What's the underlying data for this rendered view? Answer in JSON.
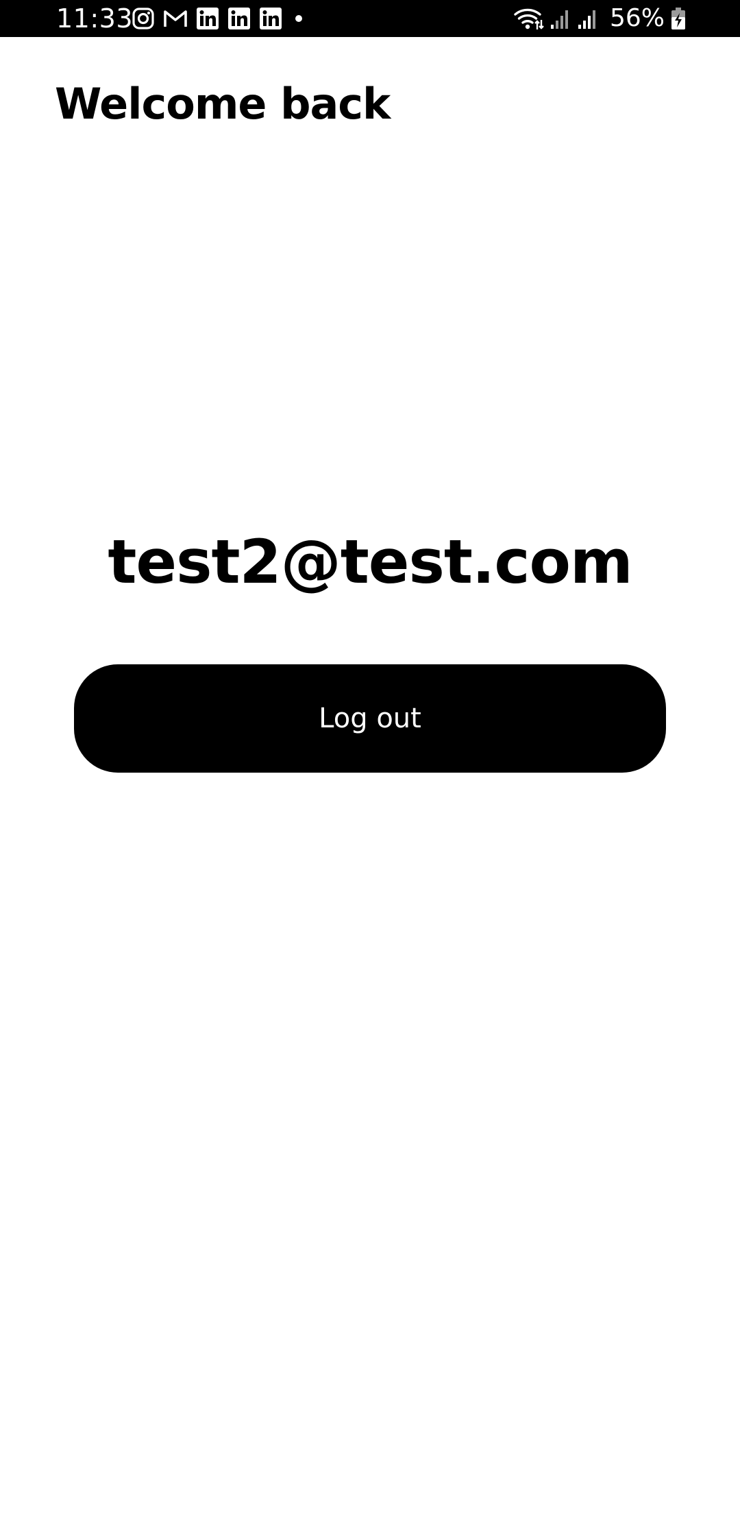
{
  "status_bar": {
    "time": "11:33",
    "notification_icons": [
      "instagram-icon",
      "gmail-icon",
      "linkedin-icon",
      "linkedin-icon",
      "linkedin-icon",
      "dot-icon"
    ],
    "system_icons": [
      "wifi-icon",
      "signal-icon",
      "signal-icon",
      "battery-charging-icon"
    ],
    "battery_percent": "56%"
  },
  "screen": {
    "title": "Welcome back",
    "user_email": "test2@test.com",
    "logout_label": "Log out"
  },
  "colors": {
    "background": "#ffffff",
    "status_bar": "#000000",
    "primary_button": "#000000",
    "button_text": "#ffffff",
    "text": "#000000"
  }
}
